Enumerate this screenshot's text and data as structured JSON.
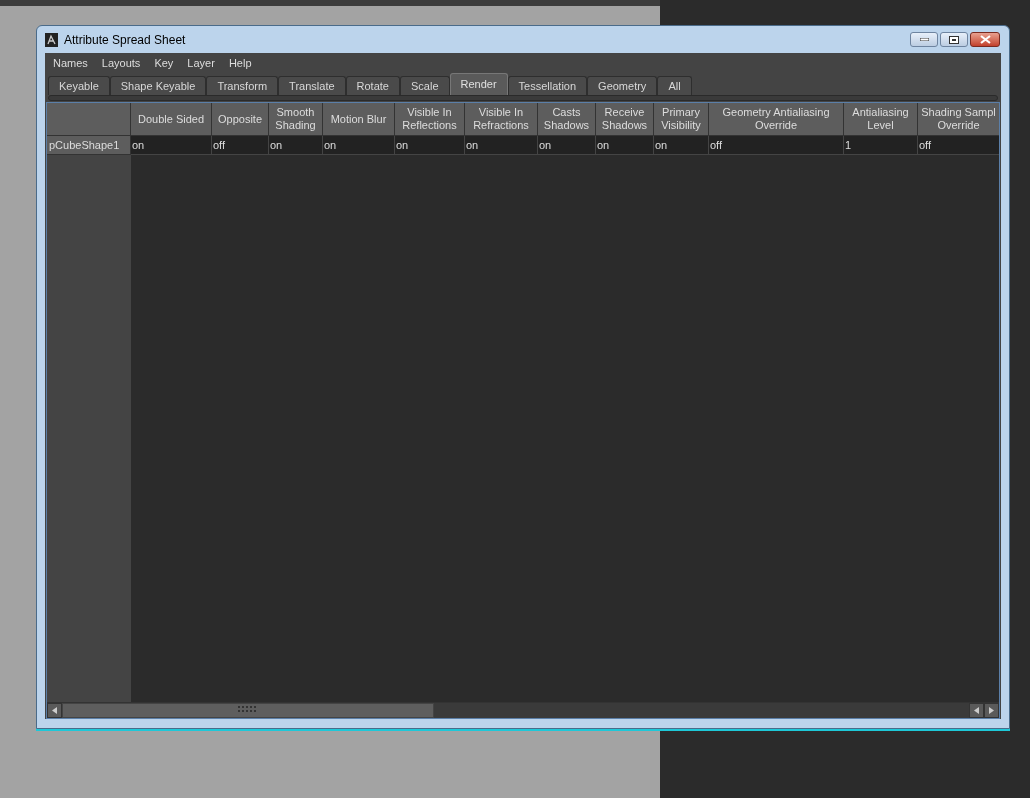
{
  "window": {
    "title": "Attribute Spread Sheet"
  },
  "menu": [
    "Names",
    "Layouts",
    "Key",
    "Layer",
    "Help"
  ],
  "tabs": [
    {
      "label": "Keyable",
      "selected": false
    },
    {
      "label": "Shape Keyable",
      "selected": false
    },
    {
      "label": "Transform",
      "selected": false
    },
    {
      "label": "Translate",
      "selected": false
    },
    {
      "label": "Rotate",
      "selected": false
    },
    {
      "label": "Scale",
      "selected": false
    },
    {
      "label": "Render",
      "selected": true
    },
    {
      "label": "Tessellation",
      "selected": false
    },
    {
      "label": "Geometry",
      "selected": false
    },
    {
      "label": "All",
      "selected": false
    }
  ],
  "table": {
    "columns": [
      "Double Sided",
      "Opposite",
      "Smooth\nShading",
      "Motion Blur",
      "Visible In\nReflections",
      "Visible In\nRefractions",
      "Casts\nShadows",
      "Receive\nShadows",
      "Primary\nVisibility",
      "Geometry Antialiasing\nOverride",
      "Antialiasing\nLevel",
      "Shading Sampl\nOverride"
    ],
    "rows": [
      {
        "name": "pCubeShape1",
        "cells": [
          "on",
          "off",
          "on",
          "on",
          "on",
          "on",
          "on",
          "on",
          "on",
          "off",
          "1",
          "off"
        ]
      }
    ]
  }
}
